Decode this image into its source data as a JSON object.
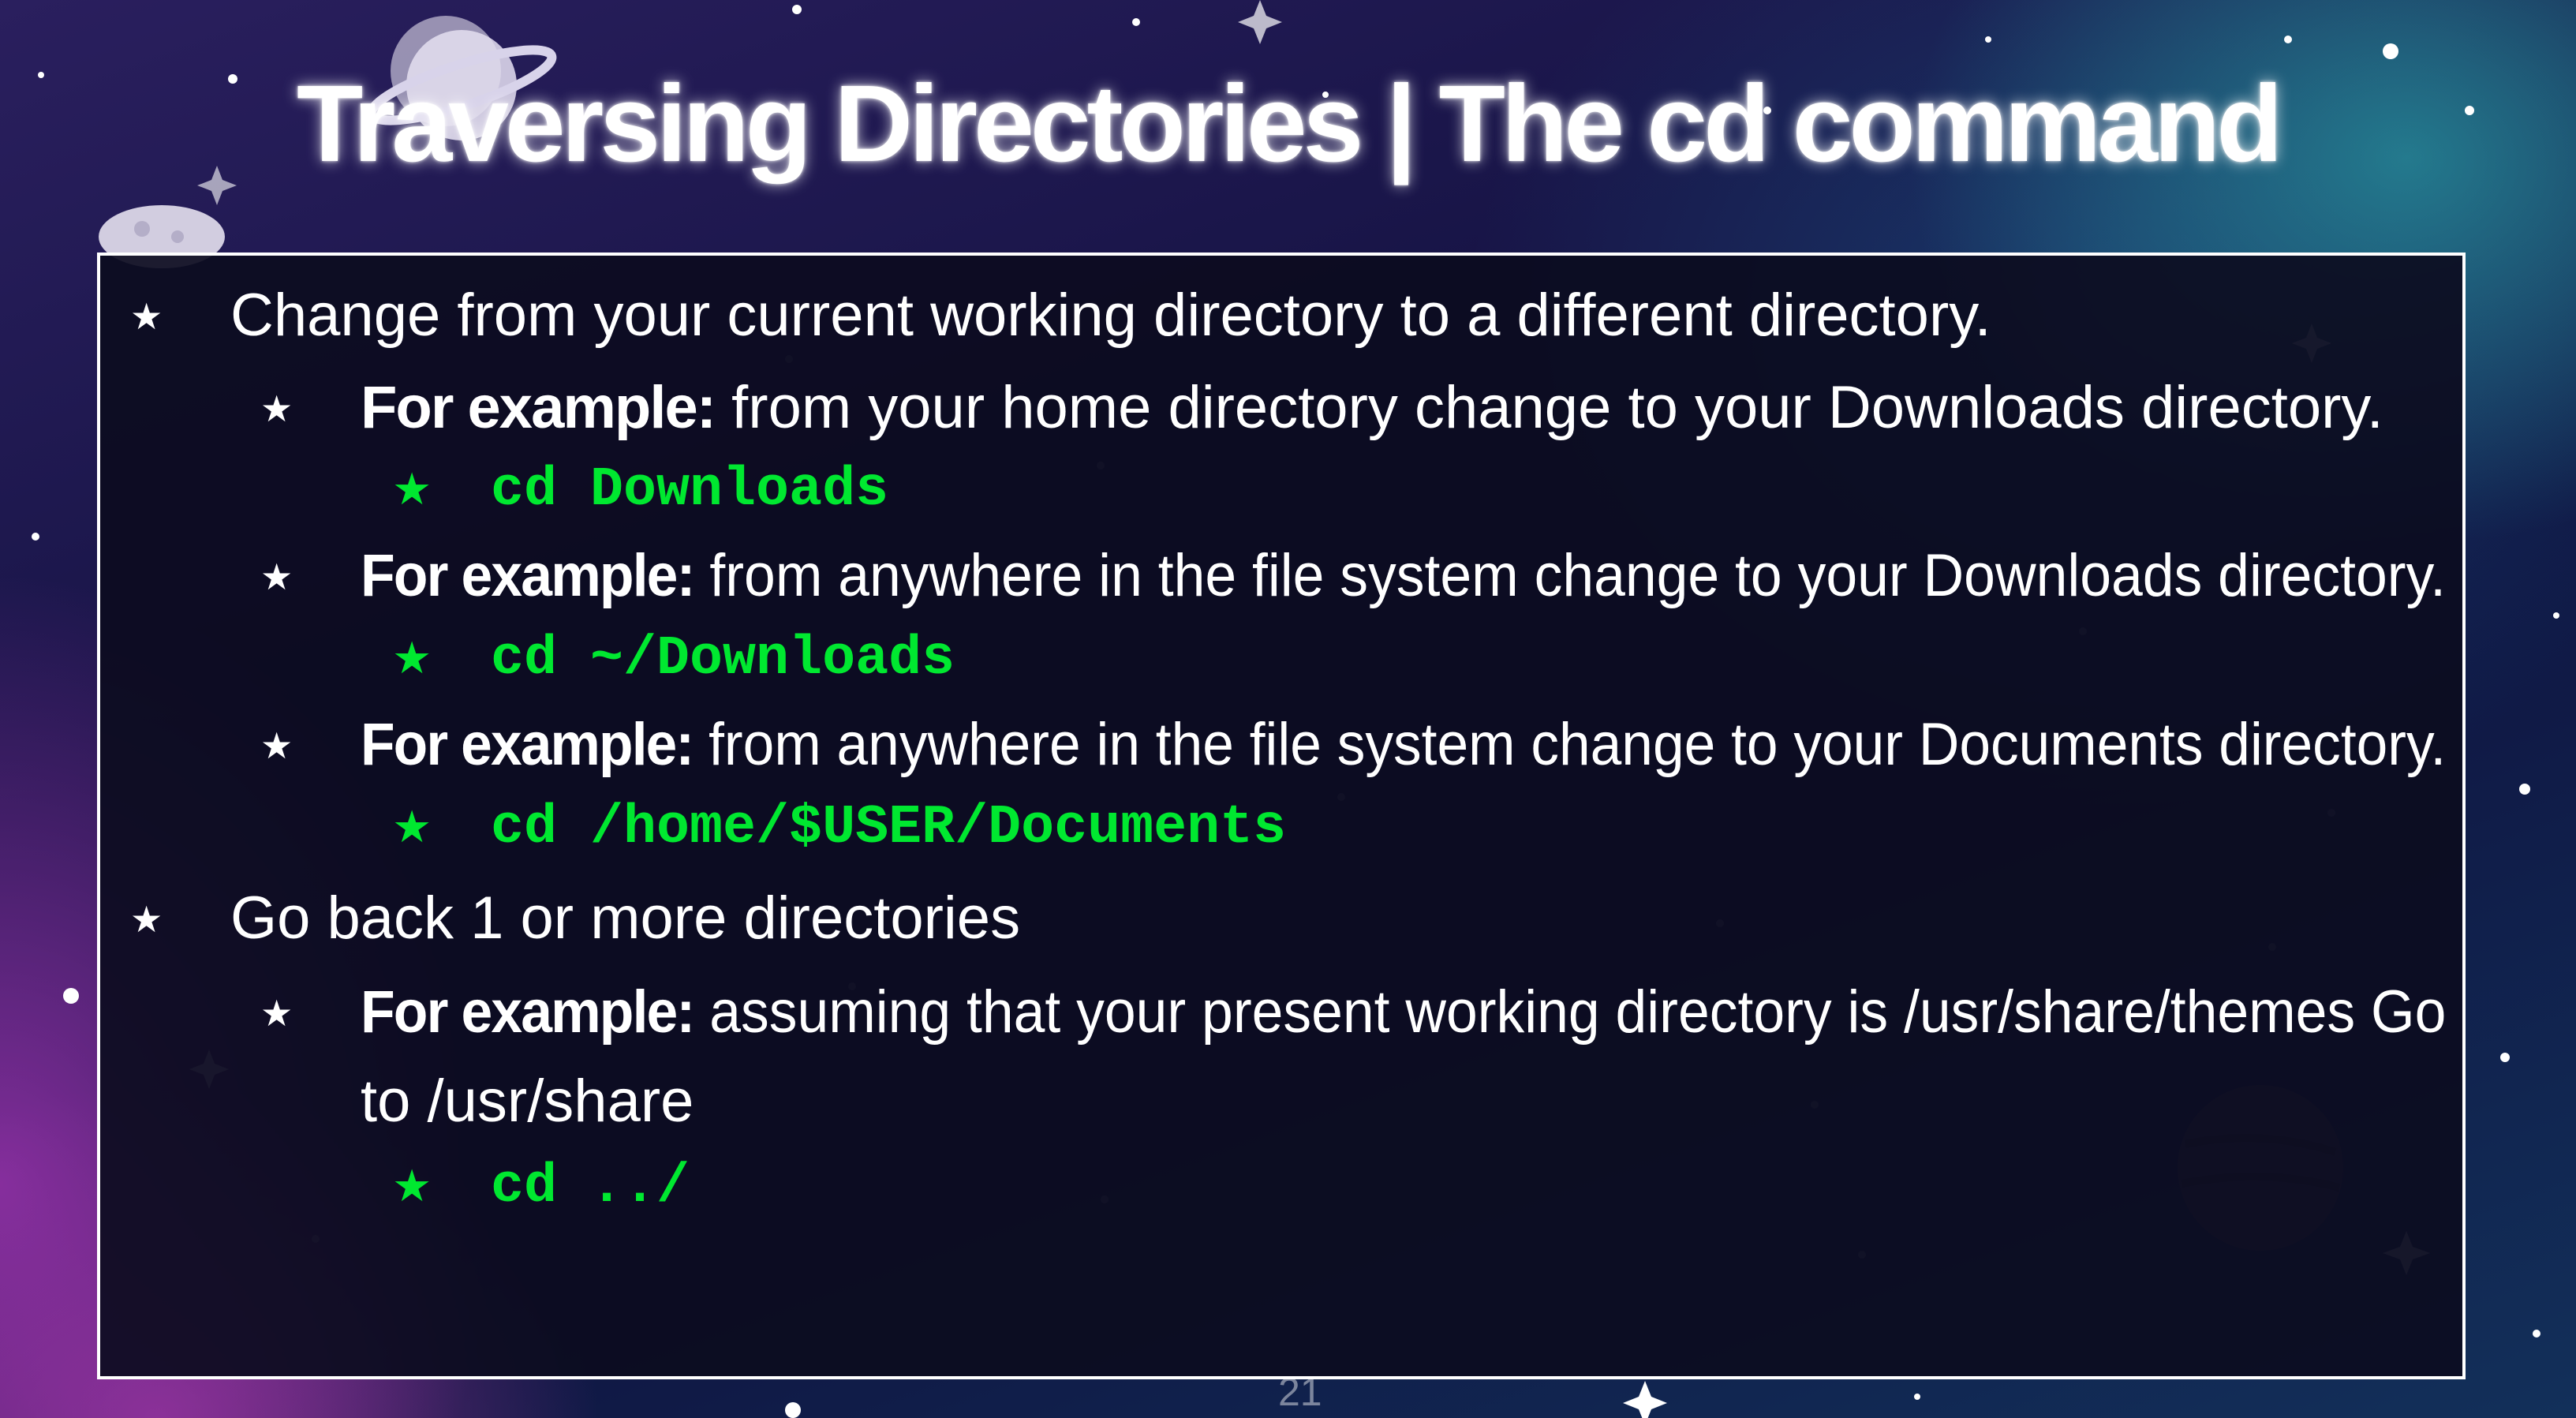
{
  "slide": {
    "title": "Traversing Directories | The cd command",
    "page_number": "21"
  },
  "bullets": [
    {
      "level": 1,
      "text": "Change from your current working directory to a different directory."
    },
    {
      "level": 2,
      "label": "For example:",
      "text": " from your home directory change to your Downloads directory."
    },
    {
      "level": 3,
      "code": "cd Downloads"
    },
    {
      "level": 2,
      "label": "For example:",
      "text": " from anywhere in the file system change to your Downloads directory."
    },
    {
      "level": 3,
      "code": "cd ~/Downloads"
    },
    {
      "level": 2,
      "label": "For example:",
      "text": " from anywhere in the file system change to your Documents directory."
    },
    {
      "level": 3,
      "code": "cd /home/$USER/Documents"
    },
    {
      "level": 1,
      "text": "Go back 1 or more directories"
    },
    {
      "level": 2,
      "label": "For example:",
      "text": " assuming that your present working directory is /usr/share/themes Go",
      "continuation": "to /usr/share"
    },
    {
      "level": 3,
      "code": "cd ../"
    }
  ],
  "bullet_glyph": "★",
  "colors": {
    "code_green": "#00e830",
    "text": "#ffffff",
    "box_border": "#ffffff",
    "box_fill": "#0c0c20"
  },
  "icons": [
    "star-bullet-icon",
    "planet-icon",
    "moon-icon",
    "sparkle-star-icon"
  ]
}
